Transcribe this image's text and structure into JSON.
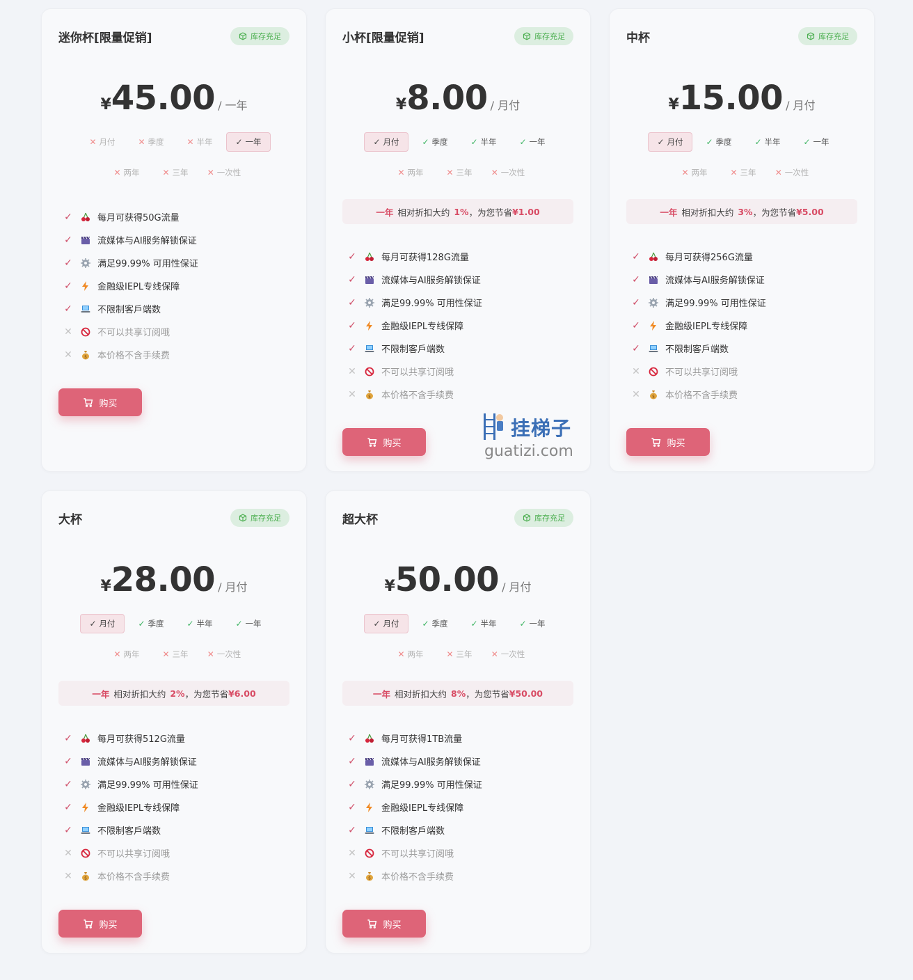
{
  "features_template": {
    "streaming": "流媒体与AI服务解锁保证",
    "uptime": "满足99.99% 可用性保证",
    "iepl": "金融级IEPL专线保障",
    "clients": "不限制客戶端数",
    "noshare": "不可以共享订阅哦",
    "fee": "本价格不含手续费"
  },
  "common": {
    "stock_label": "库存充足",
    "buy_label": "购买",
    "currency": "¥"
  },
  "cards": [
    {
      "title": "迷你杯[限量促销]",
      "price": "45.00",
      "period": "/ 一年",
      "periods_row1": [
        {
          "label": "月付",
          "state": "unavailable"
        },
        {
          "label": "季度",
          "state": "unavailable"
        },
        {
          "label": "半年",
          "state": "unavailable"
        },
        {
          "label": "一年",
          "state": "selected"
        }
      ],
      "periods_row2": [
        {
          "label": "两年",
          "state": "unavailable"
        },
        {
          "label": "三年",
          "state": "unavailable"
        },
        {
          "label": "一次性",
          "state": "unavailable"
        }
      ],
      "discount": null,
      "traffic": "每月可获得50G流量"
    },
    {
      "title": "小杯[限量促销]",
      "price": "8.00",
      "period": "/ 月付",
      "periods_row1": [
        {
          "label": "月付",
          "state": "selected"
        },
        {
          "label": "季度",
          "state": "available"
        },
        {
          "label": "半年",
          "state": "available"
        },
        {
          "label": "一年",
          "state": "available"
        }
      ],
      "periods_row2": [
        {
          "label": "两年",
          "state": "unavailable"
        },
        {
          "label": "三年",
          "state": "unavailable"
        },
        {
          "label": "一次性",
          "state": "unavailable"
        }
      ],
      "discount": {
        "period": "一年",
        "middle": "相对折扣大约",
        "pct": "1%",
        "save": "，为您节省",
        "amount": "¥1.00"
      },
      "traffic": "每月可获得128G流量"
    },
    {
      "title": "中杯",
      "price": "15.00",
      "period": "/ 月付",
      "periods_row1": [
        {
          "label": "月付",
          "state": "selected"
        },
        {
          "label": "季度",
          "state": "available"
        },
        {
          "label": "半年",
          "state": "available"
        },
        {
          "label": "一年",
          "state": "available"
        }
      ],
      "periods_row2": [
        {
          "label": "两年",
          "state": "unavailable"
        },
        {
          "label": "三年",
          "state": "unavailable"
        },
        {
          "label": "一次性",
          "state": "unavailable"
        }
      ],
      "discount": {
        "period": "一年",
        "middle": "相对折扣大约",
        "pct": "3%",
        "save": "，为您节省",
        "amount": "¥5.00"
      },
      "traffic": "每月可获得256G流量"
    },
    {
      "title": "大杯",
      "price": "28.00",
      "period": "/ 月付",
      "periods_row1": [
        {
          "label": "月付",
          "state": "selected"
        },
        {
          "label": "季度",
          "state": "available"
        },
        {
          "label": "半年",
          "state": "available"
        },
        {
          "label": "一年",
          "state": "available"
        }
      ],
      "periods_row2": [
        {
          "label": "两年",
          "state": "unavailable"
        },
        {
          "label": "三年",
          "state": "unavailable"
        },
        {
          "label": "一次性",
          "state": "unavailable"
        }
      ],
      "discount": {
        "period": "一年",
        "middle": "相对折扣大约",
        "pct": "2%",
        "save": "，为您节省",
        "amount": "¥6.00"
      },
      "traffic": "每月可获得512G流量"
    },
    {
      "title": "超大杯",
      "price": "50.00",
      "period": "/ 月付",
      "periods_row1": [
        {
          "label": "月付",
          "state": "selected"
        },
        {
          "label": "季度",
          "state": "available"
        },
        {
          "label": "半年",
          "state": "available"
        },
        {
          "label": "一年",
          "state": "available"
        }
      ],
      "periods_row2": [
        {
          "label": "两年",
          "state": "unavailable"
        },
        {
          "label": "三年",
          "state": "unavailable"
        },
        {
          "label": "一次性",
          "state": "unavailable"
        }
      ],
      "discount": {
        "period": "一年",
        "middle": "相对折扣大约",
        "pct": "8%",
        "save": "，为您节省",
        "amount": "¥50.00"
      },
      "traffic": "每月可获得1TB流量"
    }
  ],
  "watermark": {
    "cn": "挂梯子",
    "en": "guatizi.com"
  },
  "colors": {
    "accent": "#de6478",
    "check_green": "#3fb564",
    "stock_green": "#4caf50",
    "background": "#f2f4f8"
  }
}
